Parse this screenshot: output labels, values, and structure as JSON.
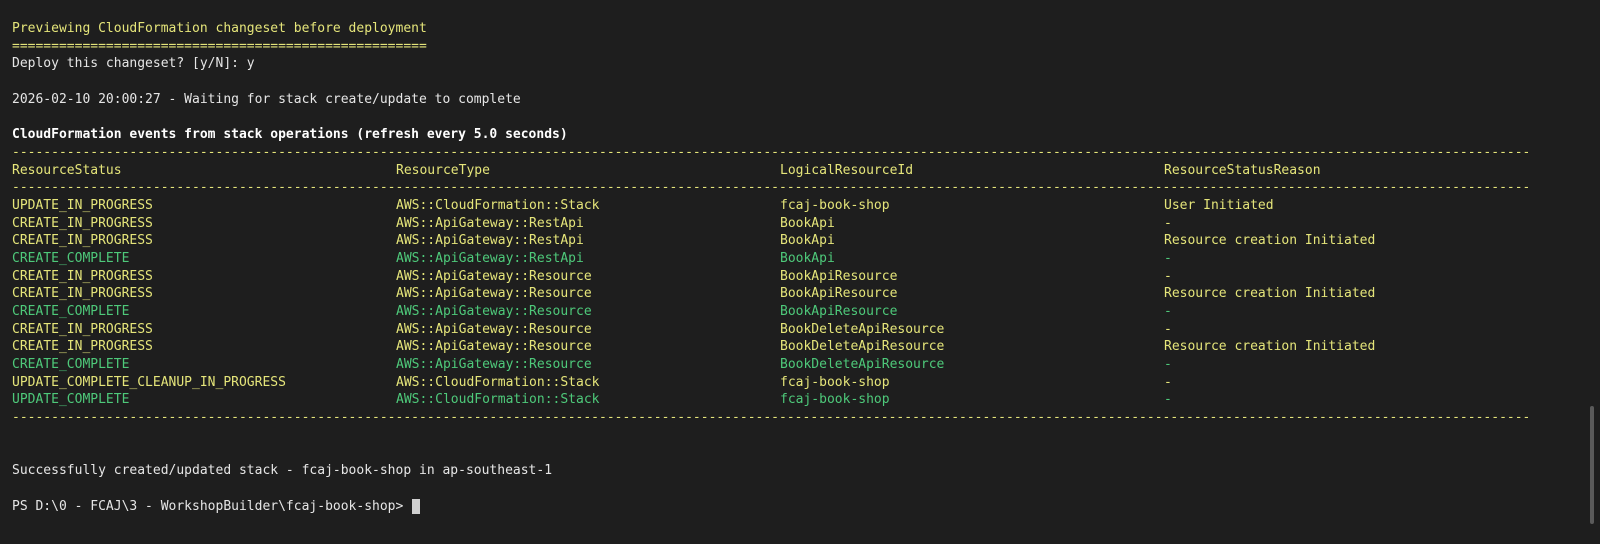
{
  "colors": {
    "background": "#1e1e1e",
    "yellow": "#e5e57a",
    "green": "#4ec97a",
    "text": "#e6e6e6"
  },
  "preview_line": "Previewing CloudFormation changeset before deployment",
  "equals_rule": "=====================================================",
  "deploy_prompt": "Deploy this changeset? [y/N]: y",
  "waiting_line": "2026-02-10 20:00:27 - Waiting for stack create/update to complete",
  "events_title": "CloudFormation events from stack operations (refresh every 5.0 seconds)",
  "dash_rule": "--------------------------------------------------------------------------------------------------------------------------------------------------------------------------------------------------------",
  "table": {
    "headers": [
      "ResourceStatus",
      "ResourceType",
      "LogicalResourceId",
      "ResourceStatusReason"
    ],
    "rows": [
      {
        "status": "UPDATE_IN_PROGRESS",
        "type": "AWS::CloudFormation::Stack",
        "logical_id": "fcaj-book-shop",
        "reason": "User Initiated",
        "color": "yellow"
      },
      {
        "status": "CREATE_IN_PROGRESS",
        "type": "AWS::ApiGateway::RestApi",
        "logical_id": "BookApi",
        "reason": "-",
        "color": "yellow"
      },
      {
        "status": "CREATE_IN_PROGRESS",
        "type": "AWS::ApiGateway::RestApi",
        "logical_id": "BookApi",
        "reason": "Resource creation Initiated",
        "color": "yellow"
      },
      {
        "status": "CREATE_COMPLETE",
        "type": "AWS::ApiGateway::RestApi",
        "logical_id": "BookApi",
        "reason": "-",
        "color": "green"
      },
      {
        "status": "CREATE_IN_PROGRESS",
        "type": "AWS::ApiGateway::Resource",
        "logical_id": "BookApiResource",
        "reason": "-",
        "color": "yellow"
      },
      {
        "status": "CREATE_IN_PROGRESS",
        "type": "AWS::ApiGateway::Resource",
        "logical_id": "BookApiResource",
        "reason": "Resource creation Initiated",
        "color": "yellow"
      },
      {
        "status": "CREATE_COMPLETE",
        "type": "AWS::ApiGateway::Resource",
        "logical_id": "BookApiResource",
        "reason": "-",
        "color": "green"
      },
      {
        "status": "CREATE_IN_PROGRESS",
        "type": "AWS::ApiGateway::Resource",
        "logical_id": "BookDeleteApiResource",
        "reason": "-",
        "color": "yellow"
      },
      {
        "status": "CREATE_IN_PROGRESS",
        "type": "AWS::ApiGateway::Resource",
        "logical_id": "BookDeleteApiResource",
        "reason": "Resource creation Initiated",
        "color": "yellow"
      },
      {
        "status": "CREATE_COMPLETE",
        "type": "AWS::ApiGateway::Resource",
        "logical_id": "BookDeleteApiResource",
        "reason": "-",
        "color": "green"
      },
      {
        "status": "UPDATE_COMPLETE_CLEANUP_IN_PROGRESS",
        "type": "AWS::CloudFormation::Stack",
        "logical_id": "fcaj-book-shop",
        "reason": "-",
        "color": "yellow"
      },
      {
        "status": "UPDATE_COMPLETE",
        "type": "AWS::CloudFormation::Stack",
        "logical_id": "fcaj-book-shop",
        "reason": "-",
        "color": "green"
      }
    ]
  },
  "success_line": "Successfully created/updated stack - fcaj-book-shop in ap-southeast-1",
  "prompt": "PS D:\\0 - FCAJ\\3 - WorkshopBuilder\\fcaj-book-shop> "
}
